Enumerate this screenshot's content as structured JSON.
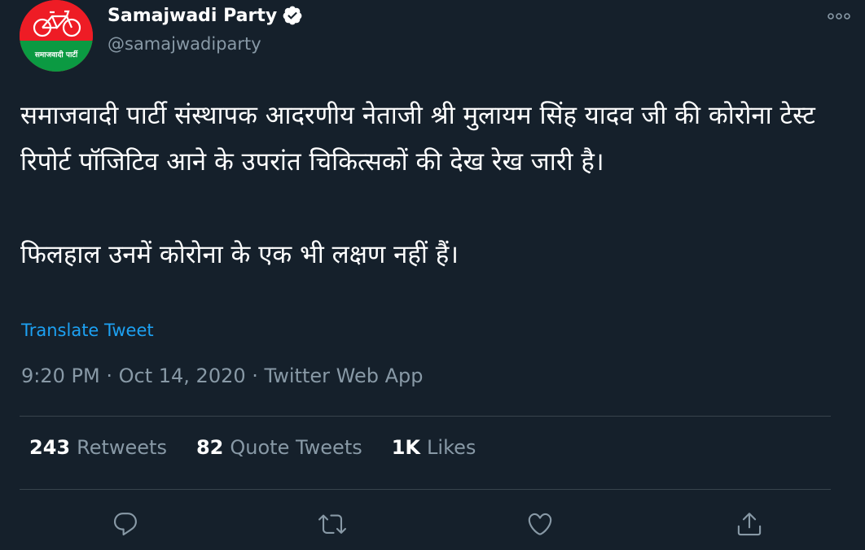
{
  "account": {
    "display_name": "Samajwadi Party",
    "handle": "@samajwadiparty",
    "verified": true,
    "avatar_text": "समाजवादी पार्टी"
  },
  "tweet": {
    "paragraphs": [
      "समाजवादी पार्टी संस्थापक आदरणीय नेताजी श्री मुलायम सिंह यादव जी की कोरोना टेस्ट रिपोर्ट पॉजिटिव आने के उपरांत चिकित्सकों की देख रेख जारी है।",
      "फिलहाल उनमें कोरोना के एक भी लक्षण नहीं हैं।"
    ],
    "translate_label": "Translate Tweet",
    "time": "9:20 PM",
    "date": "Oct 14, 2020",
    "source": "Twitter Web App",
    "separator": "·"
  },
  "stats": [
    {
      "count": "243",
      "label": "Retweets"
    },
    {
      "count": "82",
      "label": "Quote Tweets"
    },
    {
      "count": "1K",
      "label": "Likes"
    }
  ],
  "actions": [
    {
      "name": "reply",
      "icon": "reply-icon"
    },
    {
      "name": "retweet",
      "icon": "retweet-icon"
    },
    {
      "name": "like",
      "icon": "heart-icon"
    },
    {
      "name": "share",
      "icon": "share-icon"
    }
  ],
  "colors": {
    "background": "#15202b",
    "text_primary": "#ffffff",
    "text_secondary": "#8899a6",
    "link": "#1da1f2",
    "divider": "#38444d",
    "avatar_red": "#ee1c25",
    "avatar_green": "#0b9a42"
  }
}
